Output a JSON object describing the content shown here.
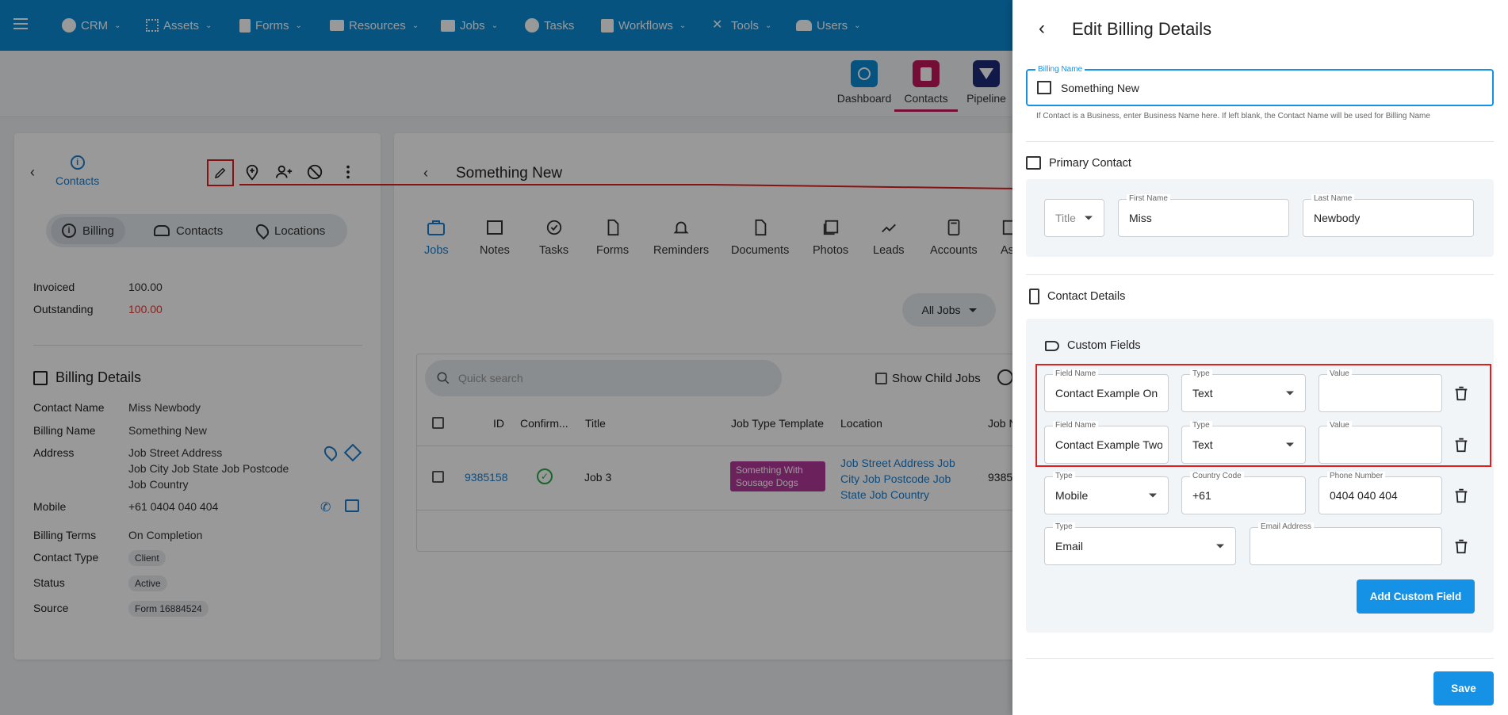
{
  "nav": {
    "items": [
      "CRM",
      "Assets",
      "Forms",
      "Resources",
      "Jobs",
      "Tasks",
      "Workflows",
      "Tools",
      "Users"
    ]
  },
  "subtabs": [
    "Dashboard",
    "Contacts",
    "Pipeline"
  ],
  "left": {
    "back_label": "Contacts",
    "segments": [
      "Billing",
      "Contacts",
      "Locations"
    ],
    "invoiced_label": "Invoiced",
    "invoiced_value": "100.00",
    "outstanding_label": "Outstanding",
    "outstanding_value": "100.00",
    "billing_title": "Billing Details",
    "rows": {
      "contact_name_label": "Contact Name",
      "contact_name": "Miss Newbody",
      "billing_name_label": "Billing Name",
      "billing_name": "Something New",
      "address_label": "Address",
      "address_1": "Job Street Address",
      "address_2": "Job City Job State Job Postcode",
      "address_3": "Job Country",
      "mobile_label": "Mobile",
      "mobile": "+61 0404 040 404",
      "billing_terms_label": "Billing Terms",
      "billing_terms": "On Completion",
      "contact_type_label": "Contact Type",
      "contact_type": "Client",
      "status_label": "Status",
      "status": "Active",
      "source_label": "Source",
      "source": "Form 16884524"
    }
  },
  "middle": {
    "title": "Something New",
    "tabs": [
      "Jobs",
      "Notes",
      "Tasks",
      "Forms",
      "Reminders",
      "Documents",
      "Photos",
      "Leads",
      "Accounts",
      "As"
    ],
    "filter": "All Jobs",
    "search_placeholder": "Quick search",
    "show_child_jobs": "Show Child Jobs",
    "columns": [
      "ID",
      "Confirm...",
      "Title",
      "Job Type Template",
      "Location",
      "Job N"
    ],
    "row": {
      "id": "9385158",
      "title": "Job 3",
      "template": "Something With Sousage Dogs",
      "location_1": "Job Street Address Job",
      "location_2": "City Job Postcode Job",
      "location_3": "State Job Country",
      "job_no": "9385"
    }
  },
  "drawer": {
    "title": "Edit Billing Details",
    "billing_name_label": "Billing Name",
    "billing_name_value": "Something New",
    "billing_hint": "If Contact is a Business, enter Business Name here. If left blank, the Contact Name will be used for Billing Name",
    "primary_contact": "Primary Contact",
    "title_placeholder": "Title",
    "first_name_label": "First Name",
    "first_name": "Miss",
    "last_name_label": "Last Name",
    "last_name": "Newbody",
    "contact_details": "Contact Details",
    "custom_fields": "Custom Fields",
    "field_name_label": "Field Name",
    "type_label": "Type",
    "value_label": "Value",
    "custom_1_name": "Contact Example On",
    "custom_1_type": "Text",
    "custom_2_name": "Contact Example Two",
    "custom_2_type": "Text",
    "country_code_label": "Country Code",
    "phone_number_label": "Phone Number",
    "phone_type": "Mobile",
    "country_code": "+61",
    "phone_number": "0404 040 404",
    "email_type": "Email",
    "email_address_label": "Email Address",
    "add_custom_field": "Add Custom Field",
    "save": "Save"
  },
  "colors": {
    "nav": "#0a8ad6",
    "accent": "#1592e6",
    "link": "#1a7fd0",
    "danger": "#e02020",
    "tag_purple": "#b23a9a",
    "green": "#2aa84a"
  }
}
